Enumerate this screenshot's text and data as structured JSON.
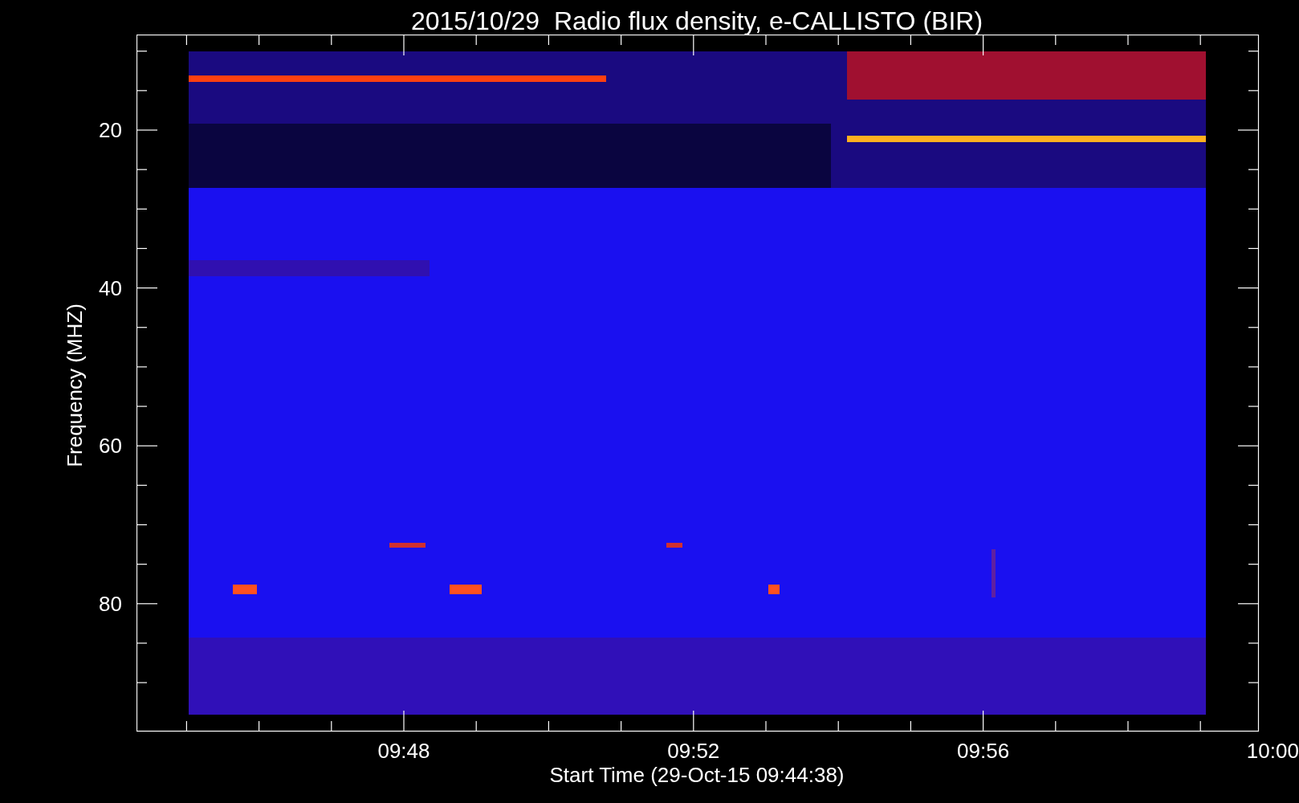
{
  "title": "2015/10/29  Radio flux density, e-CALLISTO (BIR)",
  "y_axis": {
    "label": "Frequency (MHZ)",
    "ticks": [
      "20",
      "40",
      "60",
      "80"
    ]
  },
  "x_axis": {
    "label": "Start Time (29-Oct-15 09:44:38)",
    "ticks": [
      "09:48",
      "09:52",
      "09:56",
      "10:00"
    ]
  }
}
